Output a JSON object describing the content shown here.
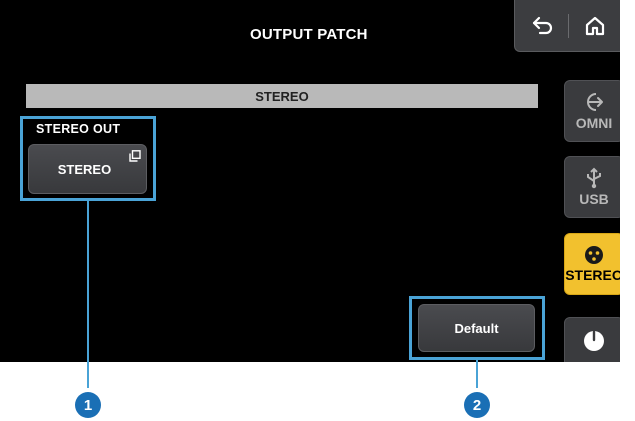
{
  "header": {
    "title": "OUTPUT PATCH"
  },
  "nav": {
    "back_icon": "back-arrow-icon",
    "home_icon": "home-icon"
  },
  "stereo_bar": {
    "label": "STEREO"
  },
  "stereo_out": {
    "heading": "STEREO OUT",
    "button_label": "STEREO",
    "button_icon": "copy-icon"
  },
  "default_button": {
    "label": "Default"
  },
  "tabs": [
    {
      "label": "OMNI",
      "icon": "output-arrow-icon",
      "active": false
    },
    {
      "label": "USB",
      "icon": "usb-icon",
      "active": false
    },
    {
      "label": "STEREO",
      "icon": "xlr-connector-icon",
      "active": true
    },
    {
      "label": "",
      "icon": "knob-icon",
      "active": false
    }
  ],
  "markers": [
    "1",
    "2"
  ],
  "colors": {
    "accent": "#f2c12e",
    "callout": "#4aa3d6",
    "marker": "#1a6fb5",
    "background": "#000000"
  }
}
